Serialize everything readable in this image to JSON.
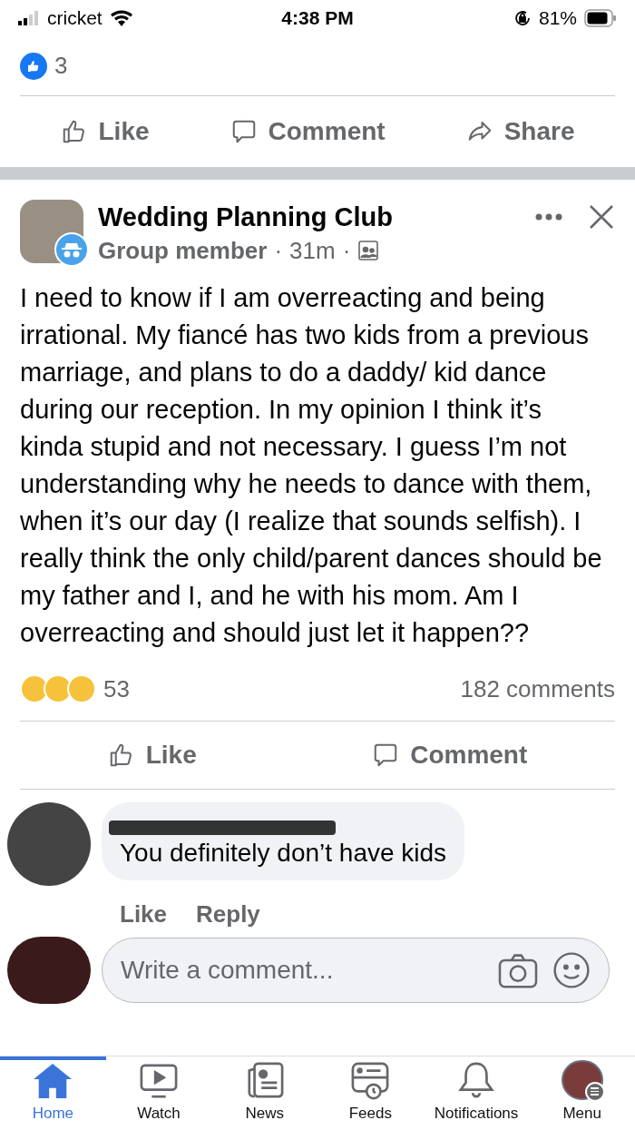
{
  "status_bar": {
    "carrier": "cricket",
    "time": "4:38 PM",
    "battery": "81%"
  },
  "previous_post": {
    "like_count": "3",
    "actions": [
      "Like",
      "Comment",
      "Share"
    ]
  },
  "post": {
    "group": "Wedding Planning Club",
    "role": "Group member",
    "separator": "·",
    "time": "31m",
    "text": "I need to know if I am overreacting and being irrational. My fiancé has two kids from a previous marriage, and plans to do a daddy/ kid dance during our reception. In my opinion I think it’s kinda stupid and not necessary. I guess I’m not understanding why he needs to dance with them, when it’s our day (I realize that sounds selfish). I really think the only child/parent dances should be my father and I, and he with his mom. Am I overreacting and should just let it happen??",
    "reaction_count": "53",
    "comment_count": "182 comments",
    "actions": [
      "Like",
      "Comment"
    ]
  },
  "comment": {
    "text": "You definitely don’t have kids",
    "actions": [
      "Like",
      "Reply"
    ]
  },
  "composer": {
    "placeholder": "Write a comment..."
  },
  "tab_bar": [
    {
      "label": "Home",
      "selected": true
    },
    {
      "label": "Watch",
      "selected": false
    },
    {
      "label": "News",
      "selected": false
    },
    {
      "label": "Feeds",
      "selected": false
    },
    {
      "label": "Notifications",
      "selected": false
    },
    {
      "label": "Menu",
      "selected": false
    }
  ]
}
